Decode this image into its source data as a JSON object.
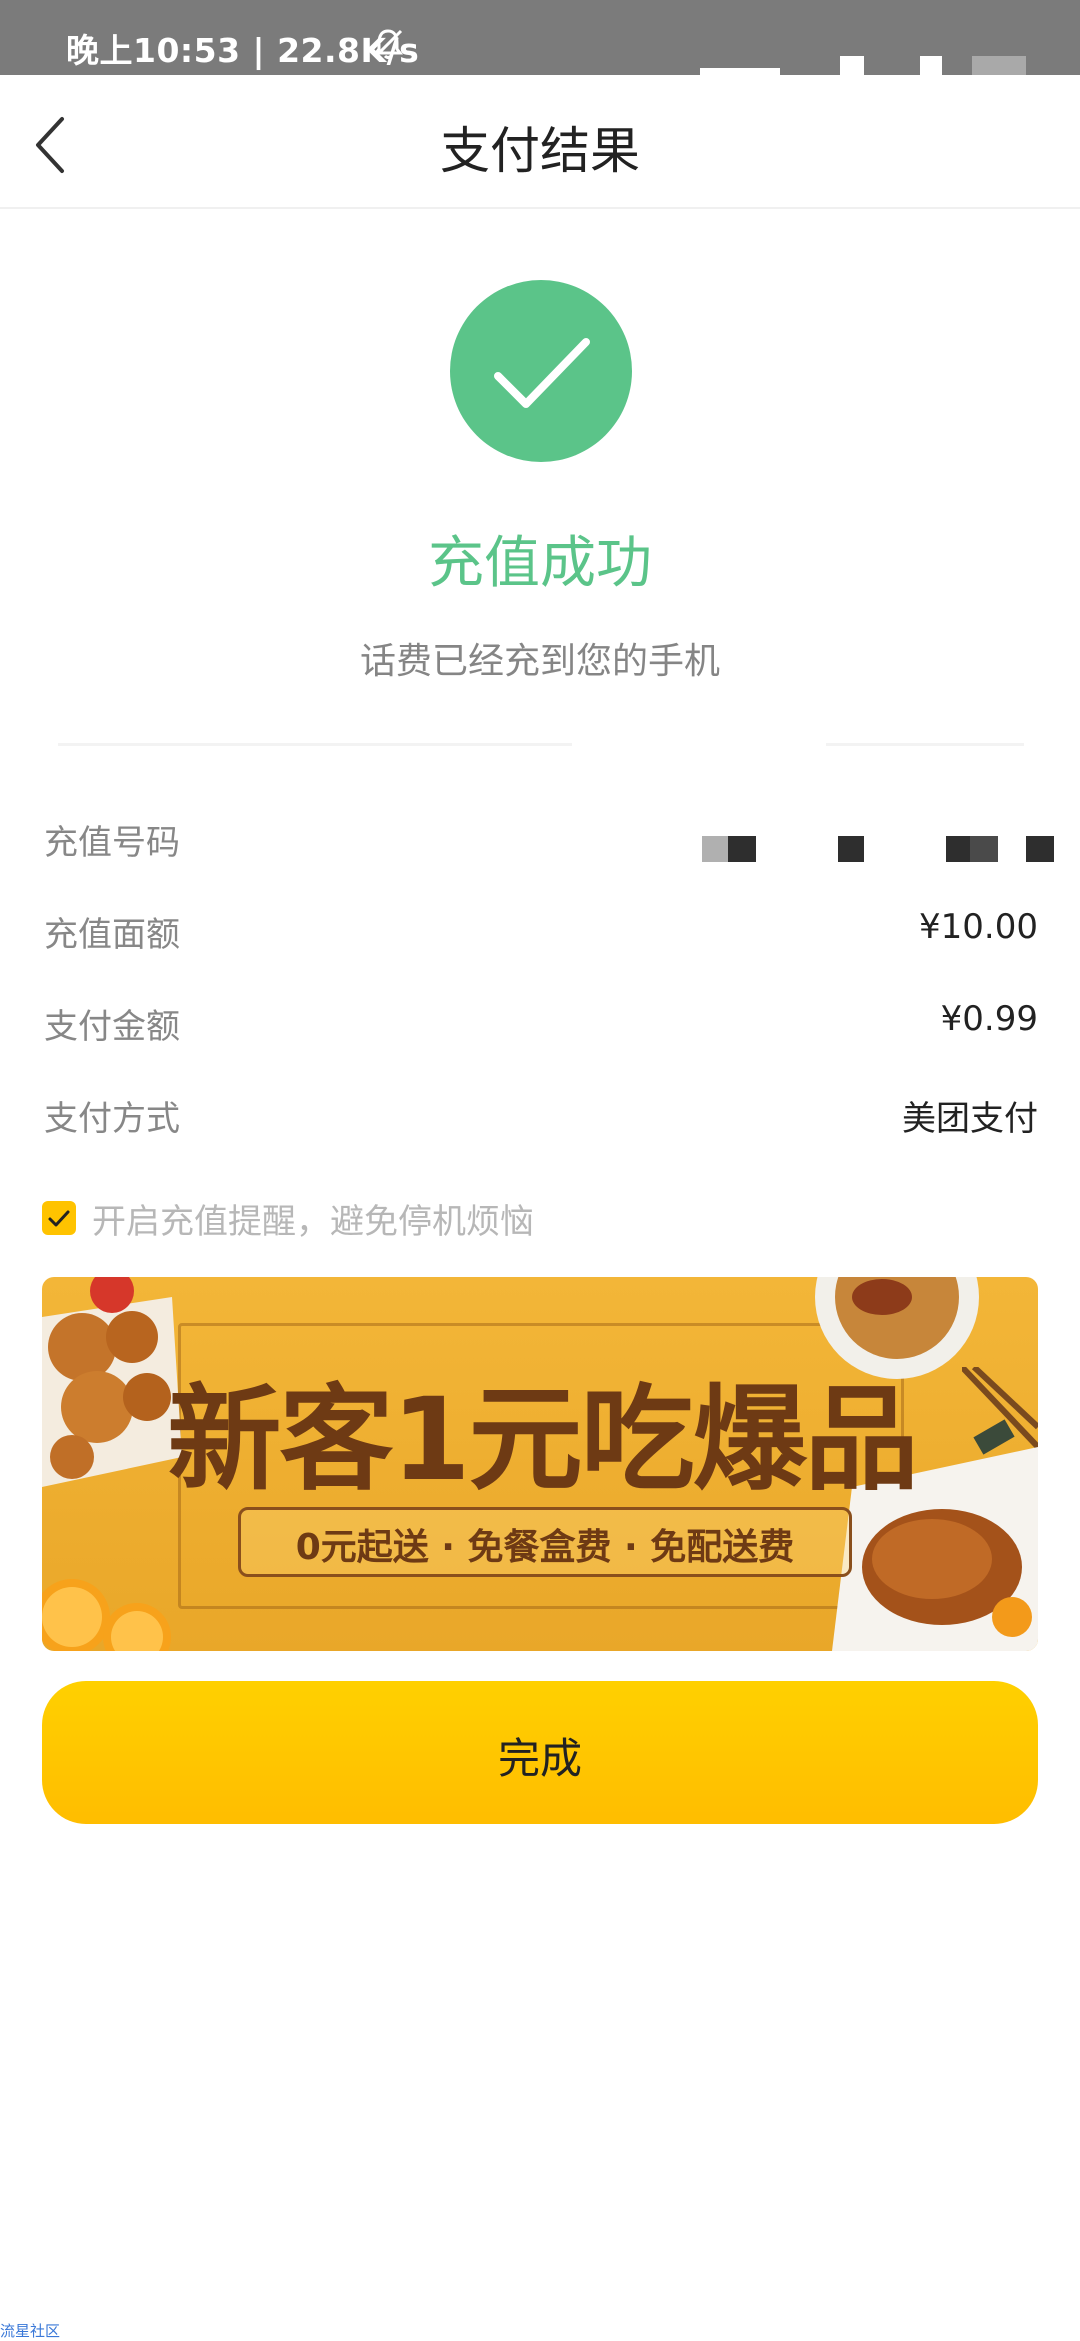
{
  "status_bar": {
    "time_speed": "晚上10:53 | 22.8K/s",
    "mute_icon": "bell-mute-icon"
  },
  "header": {
    "title": "支付结果",
    "back_icon": "chevron-left-icon"
  },
  "result": {
    "icon": "checkmark-icon",
    "title": "充值成功",
    "subtitle": "话费已经充到您的手机",
    "accent_color": "#5bc489"
  },
  "details": [
    {
      "label": "充值号码",
      "value": ""
    },
    {
      "label": "充值面额",
      "value": "¥10.00"
    },
    {
      "label": "支付金额",
      "value": "¥0.99"
    },
    {
      "label": "支付方式",
      "value": "美团支付"
    }
  ],
  "reminder": {
    "checked": true,
    "text": "开启充值提醒，避免停机烦恼",
    "check_color": "#ffc300"
  },
  "banner": {
    "headline": "新客1元吃爆品",
    "subline": "0元起送 · 免餐盒费 · 免配送费"
  },
  "actions": {
    "done_label": "完成",
    "button_color": "#ffc700"
  },
  "watermark": "流星社区"
}
